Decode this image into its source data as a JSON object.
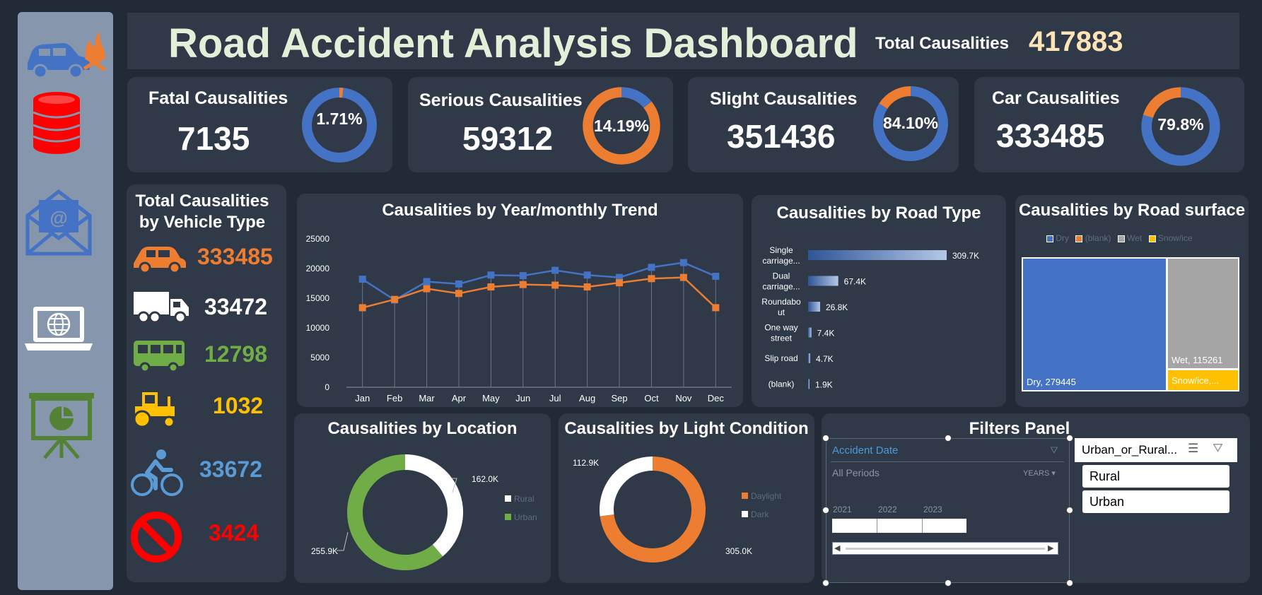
{
  "dashboard": {
    "title": "Road Accident Analysis Dashboard",
    "total_label": "Total Causalities",
    "total_value": "417883"
  },
  "sidebar": {
    "icons": [
      "car-crash-icon",
      "database-icon",
      "email-icon",
      "laptop-globe-icon",
      "presentation-chart-icon"
    ]
  },
  "kpis": [
    {
      "label": "Fatal Causalities",
      "value": "7135",
      "pct_text": "1.71%",
      "fraction": 0.0171,
      "main_color": "#ed7d31",
      "rest_color": "#4472c4"
    },
    {
      "label": "Serious Causalities",
      "value": "59312",
      "pct_text": "14.19%",
      "fraction": 0.1419,
      "main_color": "#4472c4",
      "rest_color": "#ed7d31"
    },
    {
      "label": "Slight Causalities",
      "value": "351436",
      "pct_text": "84.10%",
      "fraction": 0.841,
      "main_color": "#4472c4",
      "rest_color": "#ed7d31"
    },
    {
      "label": "Car Causalities",
      "value": "333485",
      "pct_text": "79.8%",
      "fraction": 0.798,
      "main_color": "#4472c4",
      "rest_color": "#ed7d31"
    }
  ],
  "vehicles": {
    "title_line1": "Total Causalities",
    "title_line2": "by Vehicle Type",
    "items": [
      {
        "icon": "car-icon",
        "value": "333485",
        "color": "#ed7d31"
      },
      {
        "icon": "truck-icon",
        "value": "33472",
        "color": "#ffffff"
      },
      {
        "icon": "bus-icon",
        "value": "12798",
        "color": "#70ad47"
      },
      {
        "icon": "tractor-icon",
        "value": "1032",
        "color": "#ffc000"
      },
      {
        "icon": "bicycle-icon",
        "value": "33672",
        "color": "#5b9bd5"
      },
      {
        "icon": "no-entry-icon",
        "value": "3424",
        "color": "#ff0000"
      }
    ]
  },
  "trend": {
    "title": "Causalities by Year/monthly Trend",
    "y_ticks": [
      "25000",
      "20000",
      "15000",
      "10000",
      "5000",
      "0"
    ]
  },
  "road_type": {
    "title": "Causalities by Road Type",
    "items": [
      {
        "label_line1": "Single",
        "label_line2": "carriage...",
        "value": 309.7,
        "value_label": "309.7K"
      },
      {
        "label_line1": "Dual",
        "label_line2": "carriage...",
        "value": 67.4,
        "value_label": "67.4K"
      },
      {
        "label_line1": "Roundabo",
        "label_line2": "ut",
        "value": 26.8,
        "value_label": "26.8K"
      },
      {
        "label_line1": "One way",
        "label_line2": "street",
        "value": 7.4,
        "value_label": "7.4K"
      },
      {
        "label_line1": "Slip road",
        "label_line2": "",
        "value": 4.7,
        "value_label": "4.7K"
      },
      {
        "label_line1": "(blank)",
        "label_line2": "",
        "value": 1.9,
        "value_label": "1.9K"
      }
    ]
  },
  "road_surface": {
    "title": "Causalities by Road surface",
    "legend": [
      {
        "name": "Dry",
        "color": "#4472c4"
      },
      {
        "name": "(blank)",
        "color": "#ed7d31"
      },
      {
        "name": "Wet",
        "color": "#a5a5a5"
      },
      {
        "name": "Snow/ice",
        "color": "#ffc000"
      }
    ],
    "tiles": {
      "dry": "Dry, 279445",
      "wet": "Wet, 115261",
      "snow": "Snow/ice,..."
    }
  },
  "location": {
    "title": "Causalities by Location",
    "rural_label": "162.0K",
    "urban_label": "255.9K",
    "legend": [
      {
        "name": "Rural",
        "color": "#ffffff"
      },
      {
        "name": "Urban",
        "color": "#70ad47"
      }
    ]
  },
  "light": {
    "title": "Causalities by Light Condition",
    "dark_label": "112.9K",
    "daylight_label": "305.0K",
    "legend": [
      {
        "name": "Daylight",
        "color": "#ed7d31"
      },
      {
        "name": "Dark",
        "color": "#ffffff"
      }
    ]
  },
  "filters": {
    "title": "Filters Panel",
    "timeline_header": "Accident Date",
    "all_periods": "All Periods",
    "period_unit": "YEARS",
    "years": [
      "2021",
      "2022",
      "2023"
    ],
    "slicer_header": "Urban_or_Rural...",
    "slicer_items": [
      "Rural",
      "Urban"
    ]
  },
  "chart_data": [
    {
      "type": "line",
      "title": "Causalities by Year/monthly Trend",
      "categories": [
        "Jan",
        "Feb",
        "Mar",
        "Apr",
        "May",
        "Jun",
        "Jul",
        "Aug",
        "Sep",
        "Oct",
        "Nov",
        "Dec"
      ],
      "ylim": [
        0,
        25000
      ],
      "series": [
        {
          "color": "#4472c4",
          "values": [
            18200,
            14700,
            17800,
            17400,
            18900,
            18800,
            19700,
            18900,
            18500,
            20200,
            21000,
            18700
          ]
        },
        {
          "color": "#ed7d31",
          "values": [
            13400,
            14800,
            16600,
            15800,
            16900,
            17300,
            17200,
            16900,
            17600,
            18300,
            18500,
            13400
          ]
        }
      ]
    },
    {
      "type": "bar",
      "title": "Causalities by Road Type",
      "categories": [
        "Single carriage...",
        "Dual carriage...",
        "Roundabout",
        "One way street",
        "Slip road",
        "(blank)"
      ],
      "values": [
        309.7,
        67.4,
        26.8,
        7.4,
        4.7,
        1.9
      ]
    },
    {
      "type": "heatmap",
      "title": "Causalities by Road surface",
      "categories": [
        "Dry",
        "Wet",
        "Snow/ice"
      ],
      "values": [
        279445,
        115261,
        23000
      ]
    },
    {
      "type": "pie",
      "title": "Causalities by Location",
      "categories": [
        "Rural",
        "Urban"
      ],
      "values": [
        162.0,
        255.9
      ]
    },
    {
      "type": "pie",
      "title": "Causalities by Light Condition",
      "categories": [
        "Daylight",
        "Dark"
      ],
      "values": [
        305.0,
        112.9
      ]
    }
  ]
}
